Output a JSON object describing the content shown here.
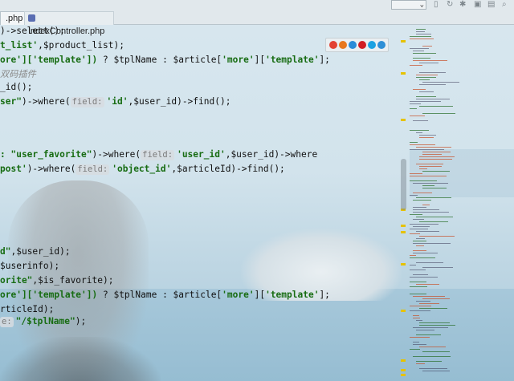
{
  "tabs": [
    {
      "label": ".php",
      "close_glyph": "×"
    },
    {
      "label": "IndexController.php"
    }
  ],
  "toolbar": {
    "dropdown_glyph": "⌄",
    "icons": [
      "bookmark-icon",
      "rerun-icon",
      "debug-icon",
      "stop-icon",
      "sync-icon",
      "search-icon"
    ]
  },
  "code_lines": [
    {
      "parts": [
        {
          "t": ")->select();",
          "c": ""
        }
      ]
    },
    {
      "parts": [
        {
          "t": "t_list'",
          "c": "str"
        },
        {
          "t": ",$product_list);",
          "c": ""
        }
      ]
    },
    {
      "parts": [
        {
          "t": "ore']['template'])",
          "c": "str"
        },
        {
          "t": " ? $tplName : $article[",
          "c": ""
        },
        {
          "t": "'more'",
          "c": "str"
        },
        {
          "t": "][",
          "c": ""
        },
        {
          "t": "'template'",
          "c": "str"
        },
        {
          "t": "];",
          "c": ""
        }
      ]
    },
    {
      "parts": [
        {
          "t": "双码插件",
          "c": "cm"
        }
      ]
    },
    {
      "parts": [
        {
          "t": "_id();",
          "c": ""
        }
      ]
    },
    {
      "parts": [
        {
          "t": "ser\"",
          "c": "str"
        },
        {
          "t": ")->where(",
          "c": ""
        },
        {
          "t": "field:",
          "c": "hint"
        },
        {
          "t": "'id'",
          "c": "str"
        },
        {
          "t": ",$user_id)->find();",
          "c": ""
        }
      ]
    },
    {
      "parts": []
    },
    {
      "parts": []
    },
    {
      "parts": [
        {
          "t": ": \"user_favorite\"",
          "c": "str"
        },
        {
          "t": ")->where(",
          "c": ""
        },
        {
          "t": "field:",
          "c": "hint"
        },
        {
          "t": "'user_id'",
          "c": "str"
        },
        {
          "t": ",$user_id)->where",
          "c": ""
        }
      ]
    },
    {
      "parts": [
        {
          "t": "post'",
          "c": "str"
        },
        {
          "t": ")->where(",
          "c": ""
        },
        {
          "t": "field:",
          "c": "hint"
        },
        {
          "t": "'object_id'",
          "c": "str"
        },
        {
          "t": ",$articleId)->find();",
          "c": ""
        }
      ]
    },
    {
      "parts": []
    },
    {
      "parts": []
    },
    {
      "parts": []
    },
    {
      "parts": []
    },
    {
      "parts": []
    },
    {
      "parts": [
        {
          "t": "d\"",
          "c": "str"
        },
        {
          "t": ",$user_id);",
          "c": ""
        }
      ]
    },
    {
      "parts": [
        {
          "t": "$userinfo);",
          "c": ""
        }
      ]
    },
    {
      "parts": [
        {
          "t": "orite\"",
          "c": "str"
        },
        {
          "t": ",$is_favorite);",
          "c": ""
        }
      ]
    },
    {
      "parts": [
        {
          "t": "ore']['template'])",
          "c": "str"
        },
        {
          "t": " ? $tplName : $article[",
          "c": ""
        },
        {
          "t": "'more'",
          "c": "str"
        },
        {
          "t": "][",
          "c": ""
        },
        {
          "t": "'template'",
          "c": "str"
        },
        {
          "t": "];",
          "c": ""
        }
      ]
    },
    {
      "parts": [
        {
          "t": "rticleId);",
          "c": ""
        }
      ]
    },
    {
      "parts": [
        {
          "t": "e:",
          "c": "hint"
        },
        {
          "t": "\"/$tplName\"",
          "c": "str"
        },
        {
          "t": ");",
          "c": ""
        }
      ]
    }
  ],
  "browser_icons": [
    {
      "name": "chrome-icon",
      "color": "#e34133"
    },
    {
      "name": "firefox-icon",
      "color": "#e8771d"
    },
    {
      "name": "safari-icon",
      "color": "#2a8bd8"
    },
    {
      "name": "opera-icon",
      "color": "#d01d24"
    },
    {
      "name": "ie-icon",
      "color": "#1ba1e2"
    },
    {
      "name": "edge-icon",
      "color": "#2f8fd6"
    }
  ],
  "colors": {
    "string": "#176c12",
    "marker": "#e6c200",
    "accent": "#5a6eb2"
  }
}
